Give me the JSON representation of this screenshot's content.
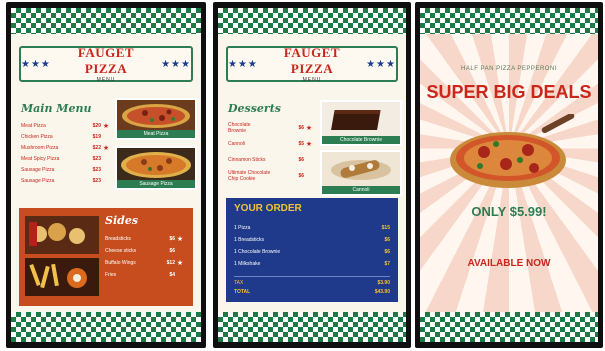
{
  "brand": {
    "name": "FAUGET PIZZA",
    "subtitle": "MENU",
    "stars": "★★★"
  },
  "menu_board": {
    "title": "Main Menu",
    "items": [
      {
        "name": "Meat Pizza",
        "price": "$20",
        "star": "★"
      },
      {
        "name": "Chicken Pizza",
        "price": "$19",
        "star": ""
      },
      {
        "name": "Mushroom Pizza",
        "price": "$22",
        "star": "★"
      },
      {
        "name": "Meat Spicy Pizza",
        "price": "$23",
        "star": ""
      },
      {
        "name": "Sausage Pizza",
        "price": "$23",
        "star": ""
      },
      {
        "name": "Sausage Pizza",
        "price": "$23",
        "star": ""
      }
    ],
    "photos": [
      {
        "caption": "Meat Pizza"
      },
      {
        "caption": "Sausage Pizza"
      }
    ],
    "sides": {
      "title": "Sides",
      "items": [
        {
          "name": "Breadsticks",
          "price": "$6",
          "star": "★"
        },
        {
          "name": "Cheese sticks",
          "price": "$6",
          "star": ""
        },
        {
          "name": "Buffalo Wings",
          "price": "$12",
          "star": "★"
        },
        {
          "name": "Fries",
          "price": "$4",
          "star": ""
        }
      ]
    }
  },
  "desserts_board": {
    "title": "Desserts",
    "items": [
      {
        "name": "Chocolate Brownie",
        "price": "$6",
        "star": "★"
      },
      {
        "name": "Cannoli",
        "price": "$5",
        "star": "★"
      },
      {
        "name": "Cinnamon Sticks",
        "price": "$6",
        "star": ""
      },
      {
        "name": "Ultimate Chocolate Chip Cookie",
        "price": "$6",
        "star": ""
      }
    ],
    "photos": [
      {
        "caption": "Chocolate Brownie"
      },
      {
        "caption": "Cannoli"
      }
    ],
    "order": {
      "title": "YOUR ORDER",
      "items": [
        {
          "name": "1 Pizza",
          "price": "$15"
        },
        {
          "name": "1 Breadsticks",
          "price": "$6"
        },
        {
          "name": "1 Chocolate Brownie",
          "price": "$6"
        },
        {
          "name": "1 Milkshake",
          "price": "$7"
        }
      ],
      "totals": [
        {
          "label": "TAX",
          "value": "$3.90"
        },
        {
          "label": "TOTAL",
          "value": "$43.90"
        }
      ]
    }
  },
  "promo_board": {
    "small_text": "HALF PAN PIZZA PEPPERONI",
    "headline": "SUPER BIG DEALS",
    "price": "ONLY $5.99!",
    "availability": "AVAILABLE NOW"
  },
  "colors": {
    "checker_green": "#1d7a45",
    "brand_red": "#c9261c",
    "menu_green": "#2d7d52",
    "sides_orange": "#c84d1e",
    "order_blue": "#1f3a8a",
    "order_gold": "#f4c430"
  }
}
